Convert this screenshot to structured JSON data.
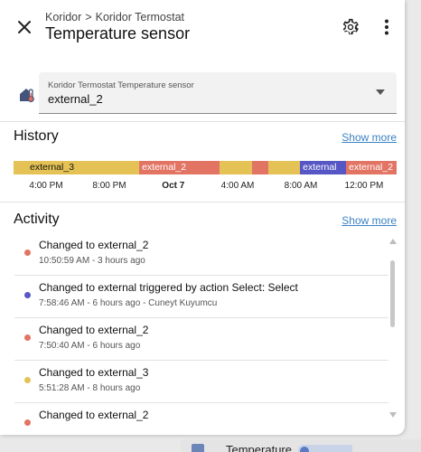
{
  "header": {
    "breadcrumb_parent": "Koridor",
    "breadcrumb_separator": ">",
    "breadcrumb_device": "Koridor Termostat",
    "title": "Temperature sensor",
    "close_icon": "close-icon",
    "settings_icon": "gear-icon",
    "more_icon": "more-vertical-icon"
  },
  "select": {
    "label": "Koridor Termostat Temperature sensor",
    "value": "external_2",
    "icon": "thermostat-home-icon"
  },
  "history": {
    "title": "History",
    "show_more": "Show more",
    "segments": [
      {
        "label": "external_3",
        "color": "#e5c255",
        "start": 0.0,
        "end": 0.328
      },
      {
        "label": "external_2",
        "color": "#e27464",
        "start": 0.328,
        "end": 0.538
      },
      {
        "label": "",
        "color": "#e5c255",
        "start": 0.538,
        "end": 0.622
      },
      {
        "label": "",
        "color": "#e27464",
        "start": 0.622,
        "end": 0.664
      },
      {
        "label": "",
        "color": "#e5c255",
        "start": 0.664,
        "end": 0.748
      },
      {
        "label": "external",
        "color": "#5656c4",
        "start": 0.748,
        "end": 0.868
      },
      {
        "label": "external_2",
        "color": "#e27464",
        "start": 0.868,
        "end": 1.0
      }
    ],
    "axis_labels": [
      {
        "text": "4:00 PM",
        "pos": 0.085,
        "bold": false
      },
      {
        "text": "8:00 PM",
        "pos": 0.25,
        "bold": false
      },
      {
        "text": "Oct 7",
        "pos": 0.417,
        "bold": true
      },
      {
        "text": "4:00 AM",
        "pos": 0.585,
        "bold": false
      },
      {
        "text": "8:00 AM",
        "pos": 0.75,
        "bold": false
      },
      {
        "text": "12:00 PM",
        "pos": 0.915,
        "bold": false
      }
    ]
  },
  "activity": {
    "title": "Activity",
    "show_more": "Show more",
    "items": [
      {
        "message": "Changed to external_2",
        "meta": "10:50:59 AM - 3 hours ago",
        "color": "#e27464"
      },
      {
        "message": "Changed to external triggered by action Select: Select",
        "meta": "7:58:46 AM - 6 hours ago - Cuneyt Kuyumcu",
        "color": "#5656c4"
      },
      {
        "message": "Changed to external_2",
        "meta": "7:50:40 AM - 6 hours ago",
        "color": "#e27464"
      },
      {
        "message": "Changed to external_3",
        "meta": "5:51:28 AM - 8 hours ago",
        "color": "#e5c255"
      },
      {
        "message": "Changed to external_2",
        "meta": "",
        "color": "#e27464"
      }
    ]
  },
  "background": {
    "partial_label": "Temperature"
  }
}
